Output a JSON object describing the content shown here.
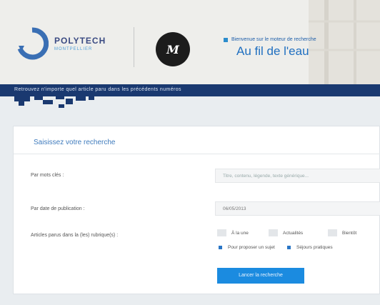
{
  "header": {
    "logo": {
      "name": "POLYTECH",
      "sub": "MONTPELLIER"
    },
    "partner_logo_letter": "M",
    "welcome": "Bienvenue sur le moteur de recherche",
    "title": "Au fil de l'eau"
  },
  "banner": {
    "text": "Retrouvez n'importe quel article paru dans les précédents numéros"
  },
  "search": {
    "heading": "Saisissez votre recherche",
    "keywords": {
      "label": "Par mots clés :",
      "placeholder": "Titre, contenu, légende, texte générique..."
    },
    "date": {
      "label": "Par date de publication :",
      "value": "06/05/2013"
    },
    "categories": {
      "label": "Articles parus dans la (les) rubrique(s) :",
      "options": [
        {
          "label": "À la une",
          "checked": false
        },
        {
          "label": "Actualités",
          "checked": false
        },
        {
          "label": "Bientôt",
          "checked": false
        },
        {
          "label": "Pour proposer un sujet",
          "checked": true
        },
        {
          "label": "Séjours pratiques",
          "checked": true
        }
      ]
    },
    "submit_label": "Lancer la recherche"
  },
  "colors": {
    "navy": "#1a3970",
    "accent": "#1b8be0",
    "title_blue": "#1f6fc0"
  }
}
